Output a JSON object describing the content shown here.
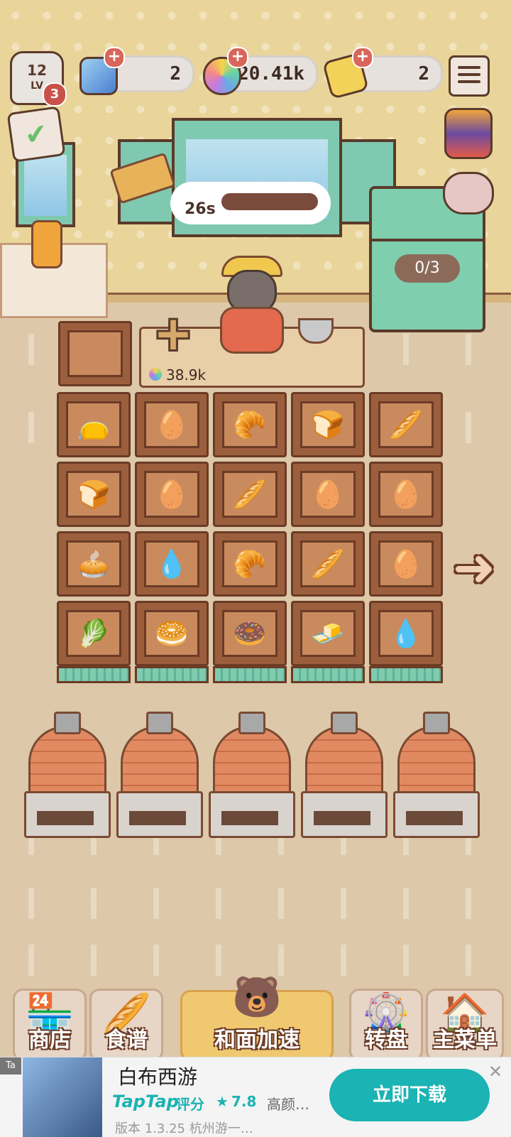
{
  "player": {
    "level": "12",
    "level_tag": "LV",
    "badge_count": "3"
  },
  "resources": [
    {
      "name": "gem",
      "icon": "blue-gem-icon",
      "value": "2"
    },
    {
      "name": "rainbow-orb",
      "icon": "rainbow-orb-icon",
      "value": "20.41k"
    },
    {
      "name": "ticket",
      "icon": "ticket-icon",
      "value": "2"
    }
  ],
  "oven_timer": {
    "label": "26s"
  },
  "fridge": {
    "progress_text": "0/3"
  },
  "add_slot": {
    "cost": "38.9k"
  },
  "grid": [
    [
      "bag-bun",
      "egg",
      "croissant",
      "toast",
      "baguette"
    ],
    [
      "toast",
      "egg",
      "baguette",
      "egg",
      "egg"
    ],
    [
      "pie-slice",
      "bag",
      "croissant",
      "baguette",
      "egg"
    ],
    [
      "herb-bread",
      "bagel",
      "donut",
      "small-bun",
      "bag"
    ]
  ],
  "grid_glyphs": {
    "bag-bun": "👝",
    "egg": "🥚",
    "croissant": "🥐",
    "toast": "🍞",
    "baguette": "🥖",
    "pie-slice": "🥧",
    "bag": "💧",
    "herb-bread": "🥬",
    "bagel": "🥯",
    "donut": "🍩",
    "small-bun": "🧈"
  },
  "nav": [
    {
      "key": "shop",
      "label": "商店",
      "icon": "🏪"
    },
    {
      "key": "recipes",
      "label": "食谱",
      "icon": "🥖"
    },
    {
      "key": "knead",
      "label": "和面加速",
      "icon": "🐻"
    },
    {
      "key": "wheel",
      "label": "转盘",
      "icon": "🎡"
    },
    {
      "key": "main_menu",
      "label": "主菜单",
      "icon": "🏠"
    }
  ],
  "ad": {
    "corner_tag": "Ta",
    "title": "白布西游",
    "brand": "TapTap",
    "rating_label": "评分",
    "rating": "7.8",
    "tagline": "高颜…",
    "version": "版本 1.3.25  杭州游一…",
    "cta": "立即下载"
  }
}
